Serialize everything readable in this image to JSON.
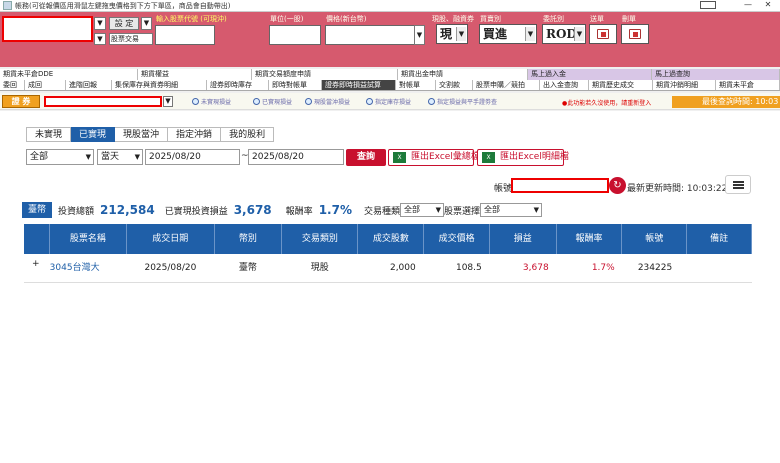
{
  "window": {
    "title": "帳務(可從報價區用滑鼠左鍵拖曳價格到下方下單區，商品會自動帶出)"
  },
  "order_panel": {
    "set_label": "設 定",
    "trade_type": "股票交易",
    "stock_code_label": "輸入股票代號 (可現沖)",
    "unit_label": "單位(一股)",
    "price_label": "價格(新台幣)",
    "margin_label": "現股、融資券",
    "buysell_label": "買賣別",
    "order_type_label": "委託別",
    "order_label": "送單",
    "cancel_label": "刪單",
    "margin_value": "現",
    "buysell_value": "買進",
    "order_type_value": "ROD"
  },
  "tabs_row1": [
    "期貨未平倉DDE",
    "期貨權益",
    "期貨交易額度申請",
    "期貨出金申請",
    "馬上過入金",
    "馬上過查詢"
  ],
  "tabs_row2": [
    "委回",
    "成回",
    "進階回報",
    "集保庫存與資券明細",
    "證券即時庫存",
    "即時對帳單",
    "證券即時損益試算",
    "對帳單",
    "交割款",
    "股票申購／競拍",
    "出入金查詢",
    "期貨歷史成交",
    "期貨沖銷明細",
    "期貨未平倉"
  ],
  "toolstrip": {
    "query_label": "證 券",
    "items": [
      "未實現損益",
      "已實現損益",
      "現股當沖損益",
      "指定庫存損益",
      "指定損益與平手證劵查"
    ],
    "warning": "●此功能若久沒使用，請重新登入",
    "last_query": "最後查詢時間: 10:03"
  },
  "pl_tabs": [
    "未實現",
    "已實現",
    "現股當沖",
    "指定沖銷",
    "我的股利"
  ],
  "filters": {
    "scope": "全部",
    "period": "當天",
    "date_from": "2025/08/20",
    "date_to": "2025/08/20",
    "query_label": "查詢",
    "export_summary": "匯出Excel彙總檔",
    "export_detail": "匯出Excel明細檔",
    "account_label": "帳號",
    "update_time": "最新更新時間: 10:03:22"
  },
  "summary": {
    "currency": "臺幣",
    "invest_label": "投資總額",
    "invest_value": "212,584",
    "realized_label": "已實現投資損益",
    "realized_value": "3,678",
    "rate_label": "報酬率",
    "rate_value": "1.7%",
    "trade_type_label": "交易種類",
    "trade_type_value": "全部",
    "stock_select_label": "股票選擇",
    "stock_select_value": "全部"
  },
  "table": {
    "headers": [
      "股票名稱",
      "成交日期",
      "幣別",
      "交易類別",
      "成交股數",
      "成交價格",
      "損益",
      "報酬率",
      "帳號",
      "備註"
    ],
    "rows": [
      {
        "expand": "+",
        "name": "3045台灣大",
        "date": "2025/08/20",
        "currency": "臺幣",
        "type": "現股",
        "qty": "2,000",
        "price": "108.5",
        "pl": "3,678",
        "rate": "1.7%",
        "account": "234225",
        "note": ""
      }
    ]
  }
}
